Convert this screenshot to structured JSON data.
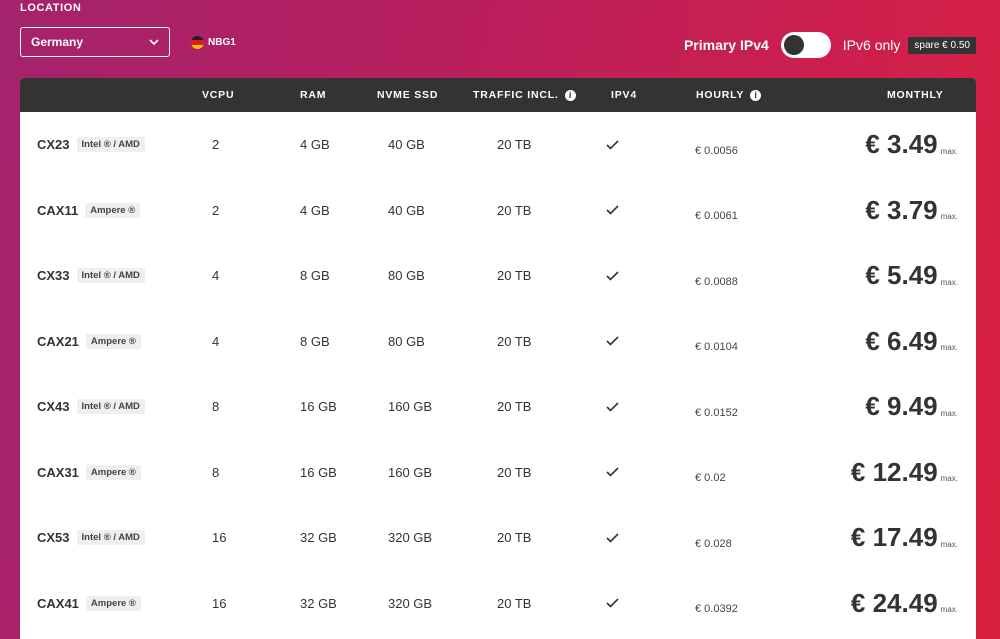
{
  "location": {
    "label": "LOCATION",
    "selected": "Germany",
    "datacenter": "NBG1"
  },
  "ip_options": {
    "primary_label": "Primary IPv4",
    "ipv6_label": "IPv6 only",
    "spare_label": "spare € 0.50",
    "ipv6_only_enabled": false
  },
  "table": {
    "headers": {
      "vcpu": "VCPU",
      "ram": "RAM",
      "ssd": "NVME SSD",
      "traffic": "TRAFFIC INCL.",
      "ipv4": "IPV4",
      "hourly": "HOURLY",
      "monthly": "MONTHLY"
    },
    "max_label": "max.",
    "rows": [
      {
        "name": "CX23",
        "cpu": "Intel ® / AMD",
        "vcpu": "2",
        "ram": "4 GB",
        "ssd": "40 GB",
        "traffic": "20 TB",
        "ipv4": true,
        "hourly": "€ 0.0056",
        "monthly": "€ 3.49"
      },
      {
        "name": "CAX11",
        "cpu": "Ampere ®",
        "vcpu": "2",
        "ram": "4 GB",
        "ssd": "40 GB",
        "traffic": "20 TB",
        "ipv4": true,
        "hourly": "€ 0.0061",
        "monthly": "€ 3.79"
      },
      {
        "name": "CX33",
        "cpu": "Intel ® / AMD",
        "vcpu": "4",
        "ram": "8 GB",
        "ssd": "80 GB",
        "traffic": "20 TB",
        "ipv4": true,
        "hourly": "€ 0.0088",
        "monthly": "€ 5.49"
      },
      {
        "name": "CAX21",
        "cpu": "Ampere ®",
        "vcpu": "4",
        "ram": "8 GB",
        "ssd": "80 GB",
        "traffic": "20 TB",
        "ipv4": true,
        "hourly": "€ 0.0104",
        "monthly": "€ 6.49"
      },
      {
        "name": "CX43",
        "cpu": "Intel ® / AMD",
        "vcpu": "8",
        "ram": "16 GB",
        "ssd": "160 GB",
        "traffic": "20 TB",
        "ipv4": true,
        "hourly": "€ 0.0152",
        "monthly": "€ 9.49"
      },
      {
        "name": "CAX31",
        "cpu": "Ampere ®",
        "vcpu": "8",
        "ram": "16 GB",
        "ssd": "160 GB",
        "traffic": "20 TB",
        "ipv4": true,
        "hourly": "€ 0.02",
        "monthly": "€ 12.49"
      },
      {
        "name": "CX53",
        "cpu": "Intel ® / AMD",
        "vcpu": "16",
        "ram": "32 GB",
        "ssd": "320 GB",
        "traffic": "20 TB",
        "ipv4": true,
        "hourly": "€ 0.028",
        "monthly": "€ 17.49"
      },
      {
        "name": "CAX41",
        "cpu": "Ampere ®",
        "vcpu": "16",
        "ram": "32 GB",
        "ssd": "320 GB",
        "traffic": "20 TB",
        "ipv4": true,
        "hourly": "€ 0.0392",
        "monthly": "€ 24.49"
      }
    ]
  },
  "colors": {
    "accent_start": "#a4236d",
    "accent_end": "#d8203f",
    "header_bg": "#333333"
  }
}
